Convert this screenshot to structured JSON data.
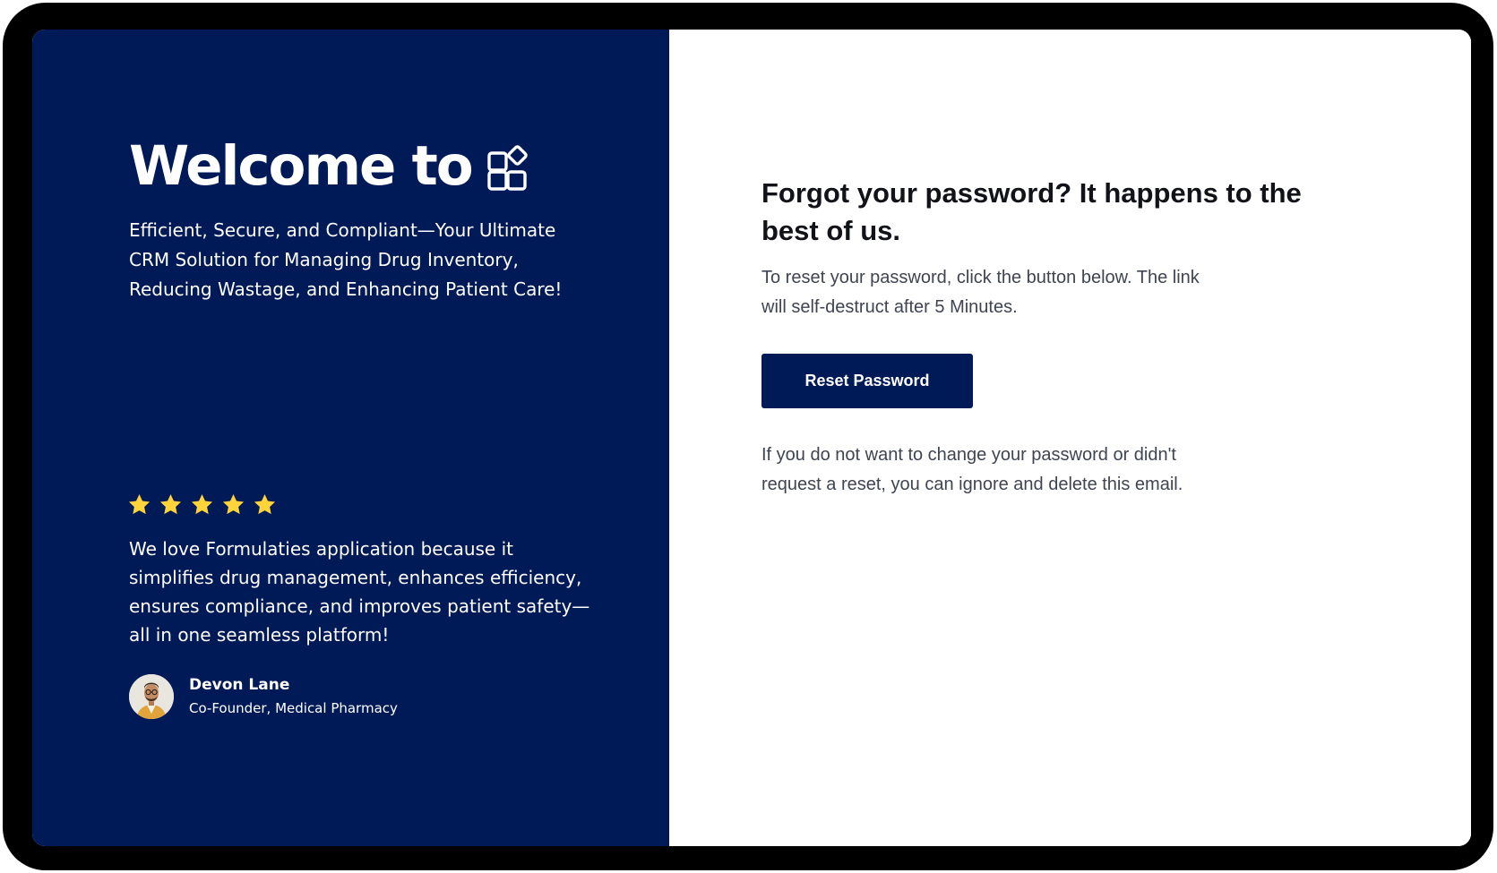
{
  "welcome_panel": {
    "title": "Welcome to",
    "logo_icon": "app-grid-logo-icon",
    "tagline": "Efficient, Secure, and Compliant—Your Ultimate CRM Solution for Managing Drug Inventory, Reducing Wastage, and Enhancing Patient Care!",
    "background_color": "#001957"
  },
  "testimonial": {
    "rating": 5,
    "rating_max": 5,
    "star_color": "#FFD43B",
    "quote": "We love Formulaties application because it simplifies drug management, enhances efficiency, ensures compliance, and improves patient safety—all in one seamless platform!",
    "author_name": "Devon Lane",
    "author_role": "Co-Founder, Medical Pharmacy",
    "avatar_icon": "person-avatar"
  },
  "reset": {
    "heading": "Forgot your password? It happens to the best of us.",
    "description": "To reset your password, click the button below. The link will self-destruct after 5 Minutes.",
    "button_label": "Reset Password",
    "ignore_note": "If you do not want to change your password or didn't request a reset, you can ignore and delete this email.",
    "accent_color": "#001957"
  }
}
